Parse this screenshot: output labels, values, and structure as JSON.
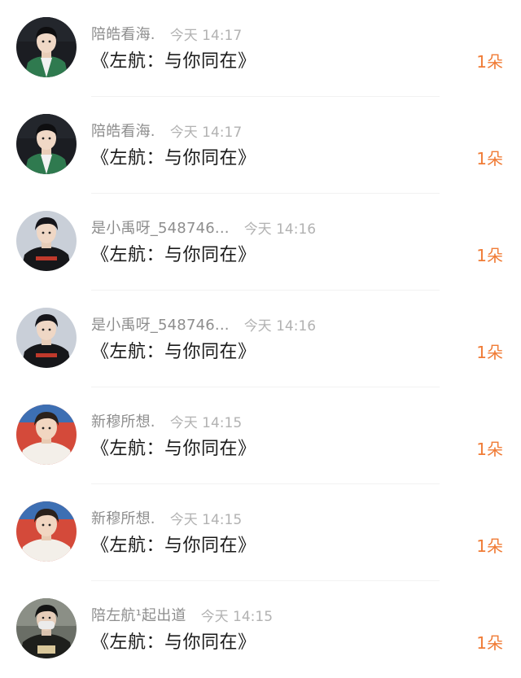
{
  "colors": {
    "name": "#8e8e8e",
    "time": "#b2b2b2",
    "message": "#1a1a1a",
    "gift": "#f07b35",
    "divider": "#f2f2f2"
  },
  "items": [
    {
      "name": "陪皓看海.",
      "time": "今天 14:17",
      "message": "《左航：与你同在》",
      "gift": "1朵",
      "avatar": "avatar-green-jacket"
    },
    {
      "name": "陪皓看海.",
      "time": "今天 14:17",
      "message": "《左航：与你同在》",
      "gift": "1朵",
      "avatar": "avatar-green-jacket"
    },
    {
      "name": "是小禹呀_548746...",
      "time": "今天 14:16",
      "message": "《左航：与你同在》",
      "gift": "1朵",
      "avatar": "avatar-black-hoodie"
    },
    {
      "name": "是小禹呀_548746...",
      "time": "今天 14:16",
      "message": "《左航：与你同在》",
      "gift": "1朵",
      "avatar": "avatar-black-hoodie"
    },
    {
      "name": "新穆所想.",
      "time": "今天 14:15",
      "message": "《左航：与你同在》",
      "gift": "1朵",
      "avatar": "avatar-white-shirt"
    },
    {
      "name": "新穆所想.",
      "time": "今天 14:15",
      "message": "《左航：与你同在》",
      "gift": "1朵",
      "avatar": "avatar-white-shirt"
    },
    {
      "name": "陪左航¹起出道",
      "time": "今天 14:15",
      "message": "《左航：与你同在》",
      "gift": "1朵",
      "avatar": "avatar-masked"
    }
  ]
}
